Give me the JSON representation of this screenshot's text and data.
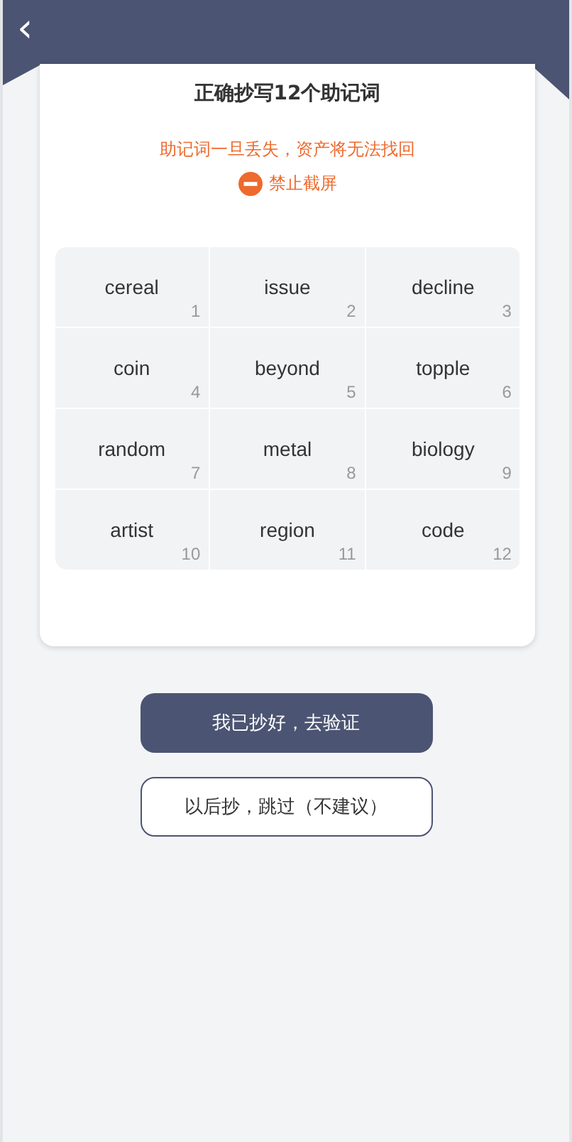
{
  "header": {
    "back": "‹"
  },
  "card": {
    "title": "正确抄写12个助记词",
    "warning": "助记词一旦丢失，资产将无法找回",
    "no_screenshot": "禁止截屏"
  },
  "words": [
    {
      "word": "cereal",
      "index": "1"
    },
    {
      "word": "issue",
      "index": "2"
    },
    {
      "word": "decline",
      "index": "3"
    },
    {
      "word": "coin",
      "index": "4"
    },
    {
      "word": "beyond",
      "index": "5"
    },
    {
      "word": "topple",
      "index": "6"
    },
    {
      "word": "random",
      "index": "7"
    },
    {
      "word": "metal",
      "index": "8"
    },
    {
      "word": "biology",
      "index": "9"
    },
    {
      "word": "artist",
      "index": "10"
    },
    {
      "word": "region",
      "index": "11"
    },
    {
      "word": "code",
      "index": "12"
    }
  ],
  "buttons": [
    {
      "label": "我已抄好，去验证",
      "kind": "primary"
    },
    {
      "label": "以后抄，跳过（不建议）",
      "kind": "outline"
    }
  ]
}
